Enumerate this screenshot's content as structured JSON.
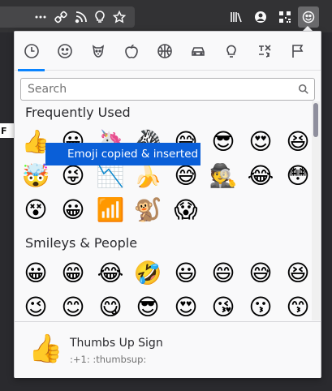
{
  "toolbar": {
    "icons": [
      "more-dots-icon",
      "url-link-icon",
      "rss-icon",
      "lightbulb-icon",
      "star-icon",
      "library-icon",
      "account-icon",
      "qr-code-icon",
      "emoji-picker-icon"
    ]
  },
  "page": {
    "fragment_text": "F"
  },
  "picker": {
    "categories": [
      "recent",
      "smileys",
      "animals",
      "food",
      "activities",
      "travel",
      "objects",
      "symbols",
      "flags"
    ],
    "active_category": "recent",
    "search_placeholder": "Search",
    "sections": [
      {
        "title": "Frequently Used",
        "emojis": [
          "👍",
          "😀",
          "🦄",
          "🦓",
          "😅",
          "😎",
          "😍",
          "😆",
          "🤯",
          "😜",
          "📉",
          "🍌",
          "😅",
          "🕵",
          "😂",
          "😳",
          "😵",
          "😀",
          "📶",
          "🐒",
          "😱"
        ]
      },
      {
        "title": "Smileys & People",
        "emojis": [
          "😀",
          "😁",
          "😂",
          "🤣",
          "😃",
          "😄",
          "😅",
          "😆",
          "😉",
          "😊",
          "😋",
          "😎",
          "😍",
          "😘",
          "😗",
          "😙"
        ]
      }
    ],
    "tooltip": "Emoji copied & inserted",
    "preview": {
      "emoji": "👍",
      "name": "Thumbs Up Sign",
      "codes": ":+1:  :thumbsup:"
    }
  }
}
